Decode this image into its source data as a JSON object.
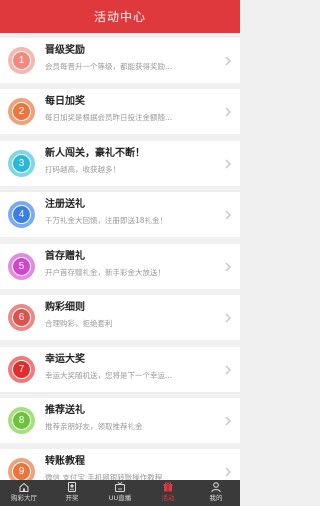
{
  "header": {
    "title": "活动中心"
  },
  "colors": {
    "brand": "#e0393d",
    "tabbar": "#3a3a3a"
  },
  "activities": [
    {
      "num": "1",
      "title": "晋级奖励",
      "desc": "会员每晋升一个等级，都能获得奖励...",
      "color_outer": "#f7b7ae",
      "color_inner": "#f08a7e"
    },
    {
      "num": "2",
      "title": "每日加奖",
      "desc": "每日加奖是根据会员昨日投注金额随...",
      "color_outer": "#f0a07a",
      "color_inner": "#e7773f"
    },
    {
      "num": "3",
      "title": "新人闯关，豪礼不断！",
      "desc": "打码越高，收获越多！",
      "color_outer": "#7fd6e8",
      "color_inner": "#2bb8d6"
    },
    {
      "num": "4",
      "title": "注册送礼",
      "desc": "千万礼金大回馈，注册即送18礼金！",
      "color_outer": "#7aaaf0",
      "color_inner": "#3b7fe4"
    },
    {
      "num": "5",
      "title": "首存赠礼",
      "desc": "开户首存赠礼金，新手彩金大放送！",
      "color_outer": "#e28be0",
      "color_inner": "#cf45cc"
    },
    {
      "num": "6",
      "title": "购彩细则",
      "desc": "合理购彩，拒绝套利",
      "color_outer": "#e98a86",
      "color_inner": "#d9534f"
    },
    {
      "num": "7",
      "title": "幸运大奖",
      "desc": "幸运大奖随机送，您将是下一个幸运...",
      "color_outer": "#ef7b7b",
      "color_inner": "#e02d2d"
    },
    {
      "num": "8",
      "title": "推荐送礼",
      "desc": "推荐亲朋好友，领取推荐礼金",
      "color_outer": "#a6e07e",
      "color_inner": "#6cc23a"
    },
    {
      "num": "9",
      "title": "转账教程",
      "desc": "微信 支付宝 手机网银转账操作教程",
      "color_outer": "#f0a07a",
      "color_inner": "#e7773f"
    }
  ],
  "tabbar": [
    {
      "label": "购彩大厅",
      "icon": "home-icon",
      "active": false
    },
    {
      "label": "开奖",
      "icon": "lottery-result-icon",
      "active": false
    },
    {
      "label": "UU直播",
      "icon": "live-tv-icon",
      "active": false
    },
    {
      "label": "活动",
      "icon": "gift-icon",
      "active": true
    },
    {
      "label": "我的",
      "icon": "user-icon",
      "active": false
    }
  ]
}
